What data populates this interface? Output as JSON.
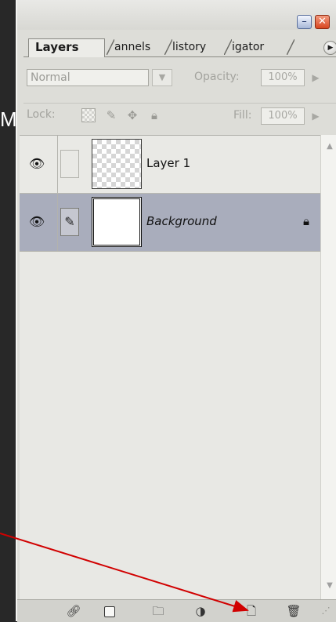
{
  "background_letter": "M",
  "window": {
    "minimize_label": "–",
    "close_label": "✕"
  },
  "tabs": [
    {
      "label": "Layers",
      "active": true
    },
    {
      "label": "annels",
      "active": false
    },
    {
      "label": "listory",
      "active": false
    },
    {
      "label": "igator",
      "active": false
    }
  ],
  "panel_menu_icon": "menu-arrow-icon",
  "blend": {
    "mode": "Normal",
    "opacity_label": "Opacity:",
    "opacity_value": "100%"
  },
  "lock": {
    "label": "Lock:",
    "fill_label": "Fill:",
    "fill_value": "100%"
  },
  "layers": [
    {
      "name": "Layer 1",
      "visible": true,
      "thumbnail": "transparent-checkerboard",
      "locked": false
    },
    {
      "name": "Background",
      "visible": true,
      "thumbnail": "white",
      "locked": true,
      "selected": true
    }
  ],
  "bottom_toolbar": [
    "link-layers-icon",
    "add-layer-mask-icon",
    "new-group-icon",
    "new-adjustment-layer-icon",
    "create-new-layer-icon",
    "delete-layer-icon"
  ],
  "colors": {
    "panel_bg": "#ddddd8",
    "selected_layer_bg": "#a9adbc",
    "annotation_arrow": "#d10000",
    "close_button": "#d8461f"
  }
}
